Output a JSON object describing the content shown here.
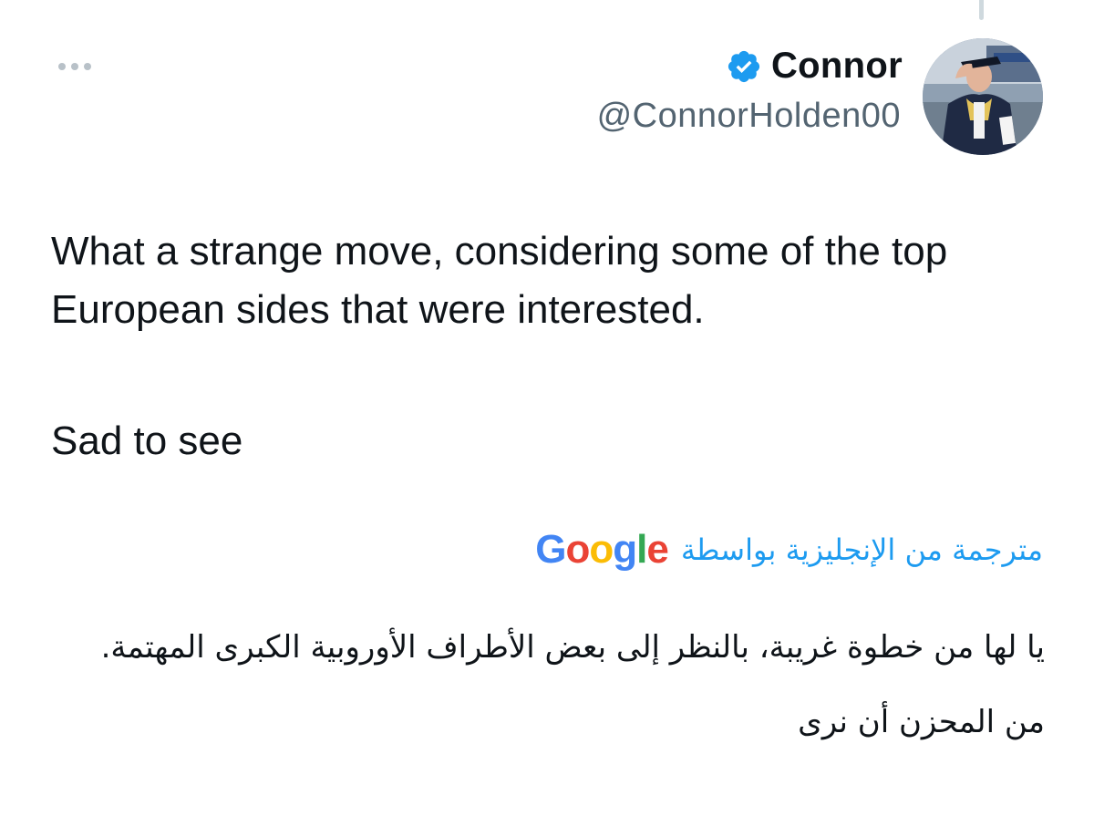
{
  "author": {
    "display_name": "Connor",
    "handle": "@ConnorHolden00",
    "verified": true,
    "verified_color": "#1d9bf0"
  },
  "more_icon": "ellipsis-icon",
  "tweet": {
    "paragraph_1": "What a strange move, considering some of the top European sides that were interested.",
    "paragraph_2": "Sad to see"
  },
  "translation": {
    "label": "مترجمة من الإنجليزية بواسطة",
    "provider": "Google",
    "paragraph_1": "يا لها من خطوة غريبة، بالنظر إلى بعض الأطراف الأوروبية الكبرى المهتمة.",
    "paragraph_2": "من المحزن أن نرى"
  },
  "colors": {
    "accent": "#1d9bf0",
    "text": "#0f1419",
    "secondary_text": "#536471",
    "google_blue": "#4285f4",
    "google_red": "#ea4335",
    "google_yellow": "#fbbc05",
    "google_green": "#34a853"
  }
}
